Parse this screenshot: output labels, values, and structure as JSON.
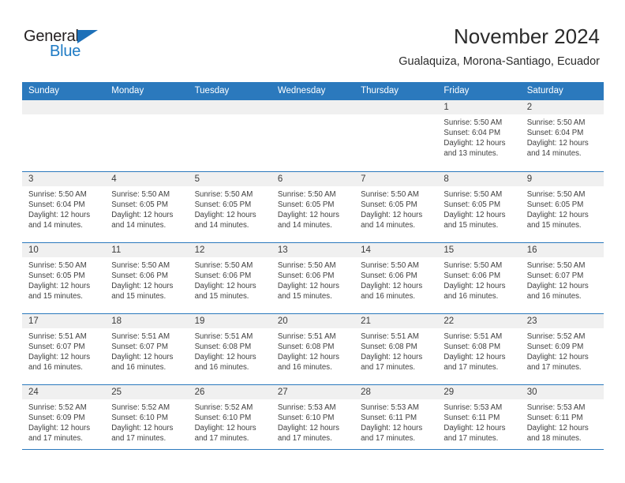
{
  "brand": {
    "name_top": "General",
    "name_bottom": "Blue",
    "accent_color": "#1d7ac4",
    "header_color": "#2b79bd"
  },
  "header": {
    "title": "November 2024",
    "subtitle": "Gualaquiza, Morona-Santiago, Ecuador"
  },
  "calendar": {
    "weekday_headers": [
      "Sunday",
      "Monday",
      "Tuesday",
      "Wednesday",
      "Thursday",
      "Friday",
      "Saturday"
    ],
    "weeks": [
      [
        {
          "day": "",
          "lines": []
        },
        {
          "day": "",
          "lines": []
        },
        {
          "day": "",
          "lines": []
        },
        {
          "day": "",
          "lines": []
        },
        {
          "day": "",
          "lines": []
        },
        {
          "day": "1",
          "lines": [
            "Sunrise: 5:50 AM",
            "Sunset: 6:04 PM",
            "Daylight: 12 hours",
            "and 13 minutes."
          ]
        },
        {
          "day": "2",
          "lines": [
            "Sunrise: 5:50 AM",
            "Sunset: 6:04 PM",
            "Daylight: 12 hours",
            "and 14 minutes."
          ]
        }
      ],
      [
        {
          "day": "3",
          "lines": [
            "Sunrise: 5:50 AM",
            "Sunset: 6:04 PM",
            "Daylight: 12 hours",
            "and 14 minutes."
          ]
        },
        {
          "day": "4",
          "lines": [
            "Sunrise: 5:50 AM",
            "Sunset: 6:05 PM",
            "Daylight: 12 hours",
            "and 14 minutes."
          ]
        },
        {
          "day": "5",
          "lines": [
            "Sunrise: 5:50 AM",
            "Sunset: 6:05 PM",
            "Daylight: 12 hours",
            "and 14 minutes."
          ]
        },
        {
          "day": "6",
          "lines": [
            "Sunrise: 5:50 AM",
            "Sunset: 6:05 PM",
            "Daylight: 12 hours",
            "and 14 minutes."
          ]
        },
        {
          "day": "7",
          "lines": [
            "Sunrise: 5:50 AM",
            "Sunset: 6:05 PM",
            "Daylight: 12 hours",
            "and 14 minutes."
          ]
        },
        {
          "day": "8",
          "lines": [
            "Sunrise: 5:50 AM",
            "Sunset: 6:05 PM",
            "Daylight: 12 hours",
            "and 15 minutes."
          ]
        },
        {
          "day": "9",
          "lines": [
            "Sunrise: 5:50 AM",
            "Sunset: 6:05 PM",
            "Daylight: 12 hours",
            "and 15 minutes."
          ]
        }
      ],
      [
        {
          "day": "10",
          "lines": [
            "Sunrise: 5:50 AM",
            "Sunset: 6:05 PM",
            "Daylight: 12 hours",
            "and 15 minutes."
          ]
        },
        {
          "day": "11",
          "lines": [
            "Sunrise: 5:50 AM",
            "Sunset: 6:06 PM",
            "Daylight: 12 hours",
            "and 15 minutes."
          ]
        },
        {
          "day": "12",
          "lines": [
            "Sunrise: 5:50 AM",
            "Sunset: 6:06 PM",
            "Daylight: 12 hours",
            "and 15 minutes."
          ]
        },
        {
          "day": "13",
          "lines": [
            "Sunrise: 5:50 AM",
            "Sunset: 6:06 PM",
            "Daylight: 12 hours",
            "and 15 minutes."
          ]
        },
        {
          "day": "14",
          "lines": [
            "Sunrise: 5:50 AM",
            "Sunset: 6:06 PM",
            "Daylight: 12 hours",
            "and 16 minutes."
          ]
        },
        {
          "day": "15",
          "lines": [
            "Sunrise: 5:50 AM",
            "Sunset: 6:06 PM",
            "Daylight: 12 hours",
            "and 16 minutes."
          ]
        },
        {
          "day": "16",
          "lines": [
            "Sunrise: 5:50 AM",
            "Sunset: 6:07 PM",
            "Daylight: 12 hours",
            "and 16 minutes."
          ]
        }
      ],
      [
        {
          "day": "17",
          "lines": [
            "Sunrise: 5:51 AM",
            "Sunset: 6:07 PM",
            "Daylight: 12 hours",
            "and 16 minutes."
          ]
        },
        {
          "day": "18",
          "lines": [
            "Sunrise: 5:51 AM",
            "Sunset: 6:07 PM",
            "Daylight: 12 hours",
            "and 16 minutes."
          ]
        },
        {
          "day": "19",
          "lines": [
            "Sunrise: 5:51 AM",
            "Sunset: 6:08 PM",
            "Daylight: 12 hours",
            "and 16 minutes."
          ]
        },
        {
          "day": "20",
          "lines": [
            "Sunrise: 5:51 AM",
            "Sunset: 6:08 PM",
            "Daylight: 12 hours",
            "and 16 minutes."
          ]
        },
        {
          "day": "21",
          "lines": [
            "Sunrise: 5:51 AM",
            "Sunset: 6:08 PM",
            "Daylight: 12 hours",
            "and 17 minutes."
          ]
        },
        {
          "day": "22",
          "lines": [
            "Sunrise: 5:51 AM",
            "Sunset: 6:08 PM",
            "Daylight: 12 hours",
            "and 17 minutes."
          ]
        },
        {
          "day": "23",
          "lines": [
            "Sunrise: 5:52 AM",
            "Sunset: 6:09 PM",
            "Daylight: 12 hours",
            "and 17 minutes."
          ]
        }
      ],
      [
        {
          "day": "24",
          "lines": [
            "Sunrise: 5:52 AM",
            "Sunset: 6:09 PM",
            "Daylight: 12 hours",
            "and 17 minutes."
          ]
        },
        {
          "day": "25",
          "lines": [
            "Sunrise: 5:52 AM",
            "Sunset: 6:10 PM",
            "Daylight: 12 hours",
            "and 17 minutes."
          ]
        },
        {
          "day": "26",
          "lines": [
            "Sunrise: 5:52 AM",
            "Sunset: 6:10 PM",
            "Daylight: 12 hours",
            "and 17 minutes."
          ]
        },
        {
          "day": "27",
          "lines": [
            "Sunrise: 5:53 AM",
            "Sunset: 6:10 PM",
            "Daylight: 12 hours",
            "and 17 minutes."
          ]
        },
        {
          "day": "28",
          "lines": [
            "Sunrise: 5:53 AM",
            "Sunset: 6:11 PM",
            "Daylight: 12 hours",
            "and 17 minutes."
          ]
        },
        {
          "day": "29",
          "lines": [
            "Sunrise: 5:53 AM",
            "Sunset: 6:11 PM",
            "Daylight: 12 hours",
            "and 17 minutes."
          ]
        },
        {
          "day": "30",
          "lines": [
            "Sunrise: 5:53 AM",
            "Sunset: 6:11 PM",
            "Daylight: 12 hours",
            "and 18 minutes."
          ]
        }
      ]
    ]
  }
}
